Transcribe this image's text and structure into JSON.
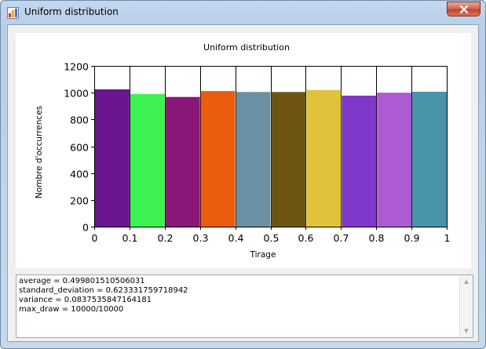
{
  "window": {
    "title": "Uniform distribution",
    "icon": "chart-app-icon",
    "close_icon": "close-icon"
  },
  "chart_data": {
    "type": "bar",
    "title": "Uniform distribution",
    "xlabel": "Tirage",
    "ylabel": "Nombre d'occurrences",
    "x_ticks": [
      "0",
      "0.1",
      "0.2",
      "0.3",
      "0.4",
      "0.5",
      "0.6",
      "0.7",
      "0.8",
      "0.9",
      "1"
    ],
    "y_ticks": [
      "0",
      "200",
      "400",
      "600",
      "800",
      "1000",
      "1200"
    ],
    "ylim": [
      0,
      1200
    ],
    "xlim": [
      0,
      1
    ],
    "grid": true,
    "bin_edges": [
      0,
      0.1,
      0.2,
      0.3,
      0.4,
      0.5,
      0.6,
      0.7,
      0.8,
      0.9,
      1.0
    ],
    "values": [
      1025,
      990,
      968,
      1012,
      1005,
      1005,
      1020,
      978,
      1000,
      1007
    ],
    "colors": [
      "#6a1590",
      "#3df250",
      "#8a1878",
      "#ea5d0f",
      "#6a90a4",
      "#6e5612",
      "#e0c33a",
      "#7f38c9",
      "#ad5bd2",
      "#4794ab"
    ]
  },
  "log": {
    "lines": [
      "average = 0.499801510506031",
      "standard_deviation = 0.623331759718942",
      "variance = 0.0837535847164181",
      "max_draw = 10000/10000"
    ],
    "scroll_up_icon": "scroll-up-arrow-icon",
    "scroll_down_icon": "scroll-down-arrow-icon"
  }
}
